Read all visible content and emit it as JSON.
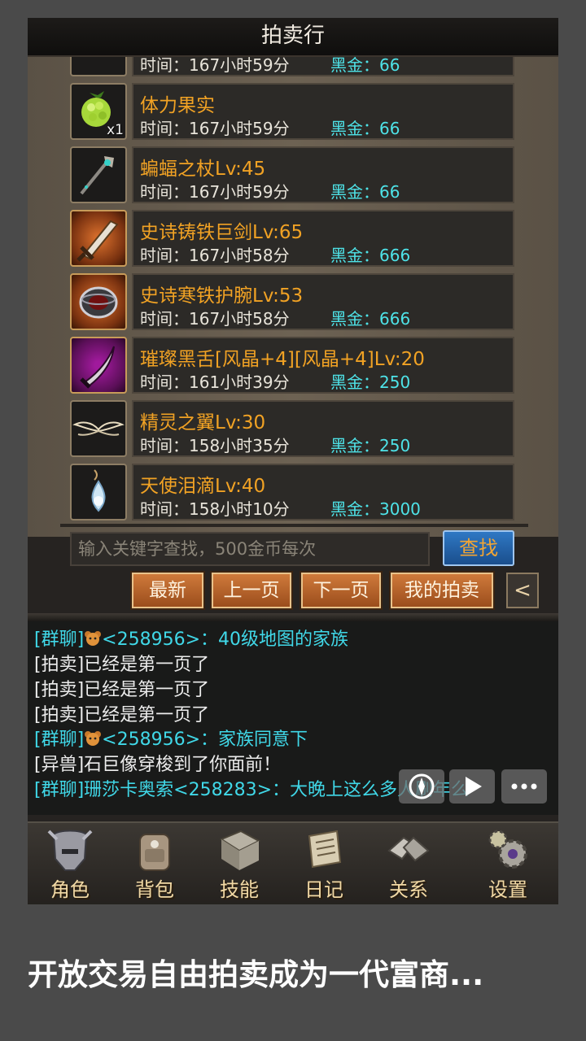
{
  "title": "拍卖行",
  "top_partial": {
    "time": "时间：167小时59分",
    "price": "黑金：66"
  },
  "items": [
    {
      "name": "体力果实",
      "time": "时间：167小时59分",
      "price": "黑金：66",
      "qty": "x1",
      "icon": "berry-icon",
      "frame": "dark"
    },
    {
      "name": "蝙蝠之杖Lv:45",
      "time": "时间：167小时59分",
      "price": "黑金：66",
      "icon": "staff-icon",
      "frame": "dark"
    },
    {
      "name": "史诗铸铁巨剑Lv:65",
      "time": "时间：167小时58分",
      "price": "黑金：666",
      "icon": "greatsword-icon",
      "frame": "orange"
    },
    {
      "name": "史诗寒铁护腕Lv:53",
      "time": "时间：167小时58分",
      "price": "黑金：666",
      "icon": "bracer-icon",
      "frame": "orange"
    },
    {
      "name": "璀璨黑舌[风晶+4][风晶+4]Lv:20",
      "time": "时间：161小时39分",
      "price": "黑金：250",
      "icon": "blade-icon",
      "frame": "purple"
    },
    {
      "name": "精灵之翼Lv:30",
      "time": "时间：158小时35分",
      "price": "黑金：250",
      "icon": "wings-icon",
      "frame": "dark"
    },
    {
      "name": "天使泪滴Lv:40",
      "time": "时间：158小时10分",
      "price": "黑金：3000",
      "icon": "teardrop-icon",
      "frame": "dark"
    }
  ],
  "search": {
    "placeholder": "输入关键字查找，500金币每次",
    "button": "查找"
  },
  "nav_buttons": {
    "latest": "最新",
    "prev": "上一页",
    "next": "下一页",
    "mine": "我的拍卖",
    "back": "<"
  },
  "chat": [
    {
      "type": "group",
      "tag": "[群聊]",
      "text": "<258956>：40级地图的家族"
    },
    {
      "type": "auction",
      "text": "[拍卖]已经是第一页了"
    },
    {
      "type": "auction",
      "text": "[拍卖]已经是第一页了"
    },
    {
      "type": "auction",
      "text": "[拍卖]已经是第一页了"
    },
    {
      "type": "group",
      "tag": "[群聊]",
      "text": "<258956>：家族同意下"
    },
    {
      "type": "system",
      "text": "[异兽]石巨像穿梭到了你面前！"
    },
    {
      "type": "group",
      "tag": "[群聊]",
      "text": "珊莎卡奥索<258283>：大晚上这么多人刷年么"
    }
  ],
  "chat_controls": [
    "compass-icon",
    "play-icon",
    "more-chat-icon"
  ],
  "bottom_nav": [
    {
      "label": "角色",
      "icon": "helmet-icon"
    },
    {
      "label": "背包",
      "icon": "backpack-icon"
    },
    {
      "label": "技能",
      "icon": "spellbook-icon"
    },
    {
      "label": "日记",
      "icon": "scroll-icon"
    },
    {
      "label": "关系",
      "icon": "handshake-icon"
    },
    {
      "label": "设置",
      "icon": "gears-icon"
    }
  ],
  "caption": "开放交易自由拍卖成为一代富商..."
}
